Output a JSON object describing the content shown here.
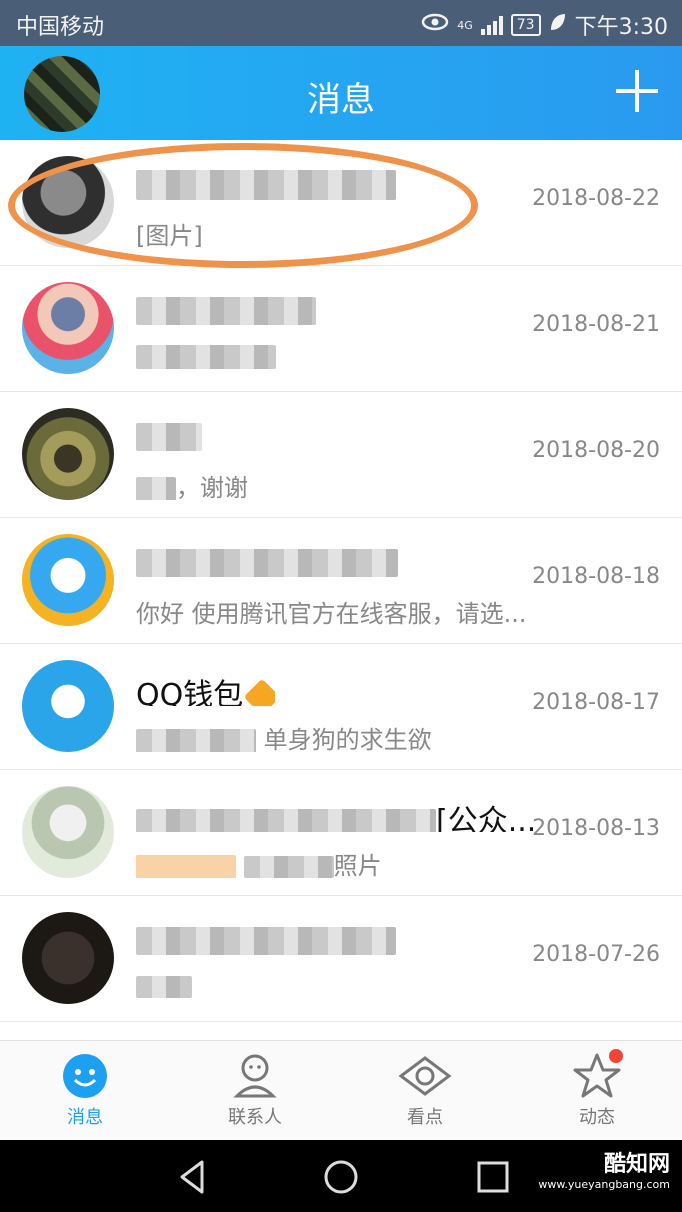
{
  "status_bar": {
    "carrier": "中国移动",
    "network": "4G",
    "battery": "73",
    "time": "下午3:30"
  },
  "header": {
    "title": "消息"
  },
  "conversations": [
    {
      "name": "",
      "preview": "[图片]",
      "date": "2018-08-22"
    },
    {
      "name": "",
      "preview": "",
      "date": "2018-08-21"
    },
    {
      "name": "",
      "preview": "，谢谢",
      "date": "2018-08-20"
    },
    {
      "name": "",
      "preview": "你好 使用腾讯官方在线客服，请选...",
      "date": "2018-08-18"
    },
    {
      "name": "QQ钱包",
      "preview": "单身狗的求生欲",
      "date": "2018-08-17"
    },
    {
      "name": "[公众...",
      "preview": "照片",
      "date": "2018-08-13"
    },
    {
      "name": "",
      "preview": "",
      "date": "2018-07-26"
    }
  ],
  "tabs": [
    {
      "label": "消息"
    },
    {
      "label": "联系人"
    },
    {
      "label": "看点"
    },
    {
      "label": "动态"
    }
  ],
  "watermark": {
    "text": "酷知网",
    "url": "www.yueyangbang.com"
  },
  "colors": {
    "accent": "#1ea0f0",
    "header": "#2a9af0",
    "annotation": "#f0934a"
  }
}
